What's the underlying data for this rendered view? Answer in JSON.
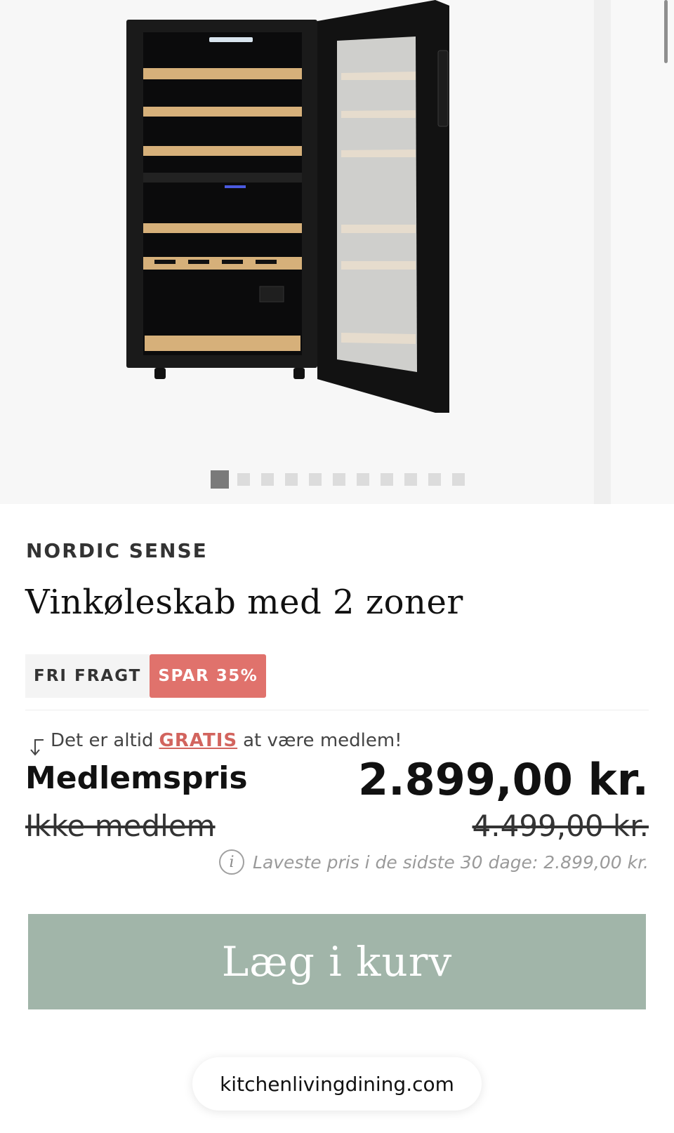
{
  "gallery": {
    "image_alt": "Vinkøleskab med 2 zoner",
    "slide_count": 11,
    "active_slide": 1
  },
  "product": {
    "brand": "NORDIC SENSE",
    "title": "Vinkøleskab med 2 zoner",
    "badges": {
      "free_shipping": "FRI FRAGT",
      "save": "SPAR 35%"
    }
  },
  "pricing": {
    "member_note_pre": "Det er altid",
    "member_note_link": "GRATIS",
    "member_note_post": "at være medlem!",
    "member_label": "Medlemspris",
    "member_price": "2.899,00 kr.",
    "nonmember_label": "Ikke medlem",
    "nonmember_price": "4.499,00 kr.",
    "lowest_price_note": "Laveste pris i de sidste 30 dage: 2.899,00 kr."
  },
  "actions": {
    "add_to_cart": "Læg i kurv"
  },
  "browser": {
    "url": "kitchenlivingdining.com"
  },
  "colors": {
    "accent_red": "#e0726c",
    "cart_button": "#a1b5a9"
  }
}
